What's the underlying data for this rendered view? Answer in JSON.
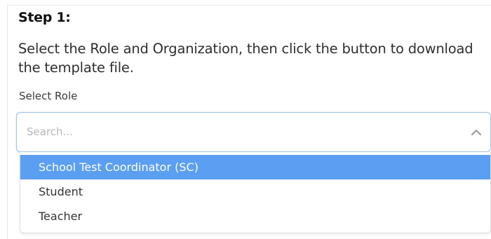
{
  "step": {
    "title": "Step 1:",
    "instructions": "Select the Role and Organization, then click the button to download the template file."
  },
  "role_select": {
    "label": "Select Role",
    "placeholder": "Search...",
    "value": "",
    "toggle_icon": "chevron-up-icon",
    "options": [
      {
        "label": "School Test Coordinator (SC)",
        "highlighted": true
      },
      {
        "label": "Student",
        "highlighted": false
      },
      {
        "label": "Teacher",
        "highlighted": false
      }
    ]
  },
  "colors": {
    "highlight": "#5b9ff2",
    "focus_border": "#9ec2ea"
  }
}
